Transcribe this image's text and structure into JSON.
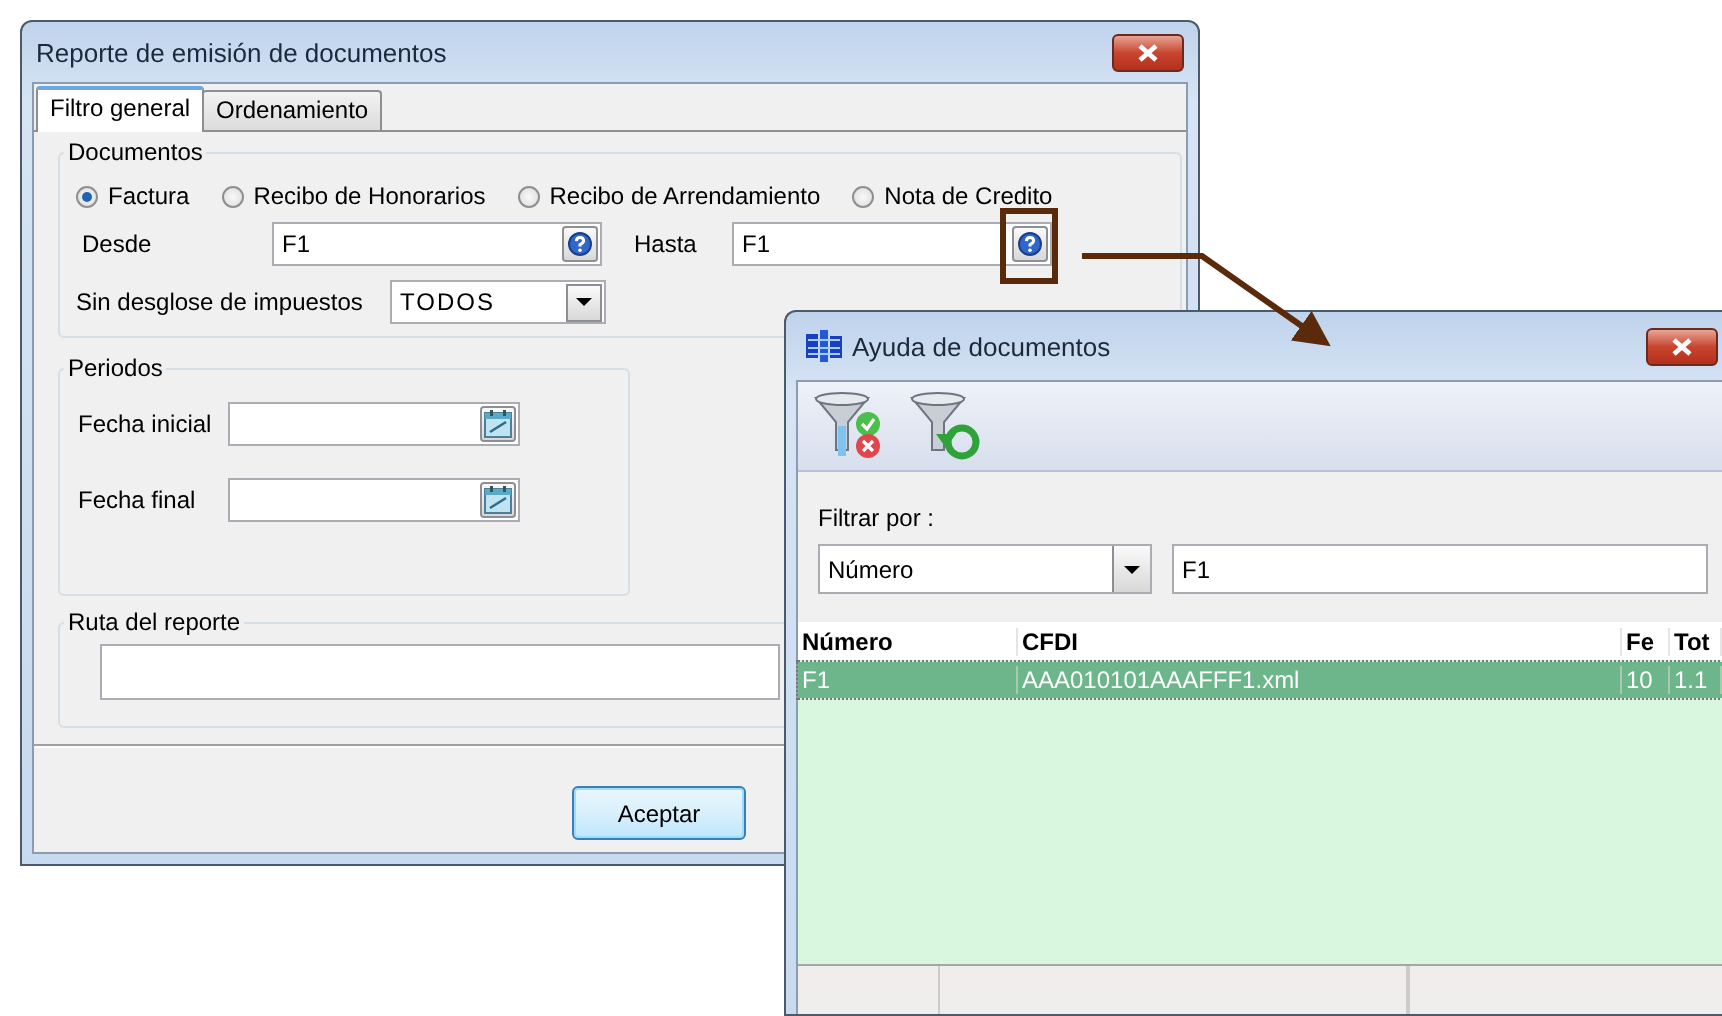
{
  "report_window": {
    "title": "Reporte de emisión de documentos",
    "tabs": [
      {
        "label": "Filtro general",
        "selected": true
      },
      {
        "label": "Ordenamiento",
        "selected": false
      }
    ],
    "documentos": {
      "legend": "Documentos",
      "options": [
        {
          "label": "Factura",
          "selected": true
        },
        {
          "label": "Recibo de Honorarios",
          "selected": false
        },
        {
          "label": "Recibo de Arrendamiento",
          "selected": false
        },
        {
          "label": "Nota de Credito",
          "selected": false
        }
      ],
      "desde": {
        "label": "Desde",
        "value": "F1"
      },
      "hasta": {
        "label": "Hasta",
        "value": "F1"
      },
      "sin_desglose": {
        "label": "Sin desglose de impuestos",
        "value": "TODOS"
      }
    },
    "periodos": {
      "legend": "Periodos",
      "fecha_inicial": {
        "label": "Fecha inicial"
      },
      "fecha_final": {
        "label": "Fecha final"
      }
    },
    "ruta": {
      "legend": "Ruta del reporte"
    },
    "buttons": [
      "Aceptar"
    ]
  },
  "help_window": {
    "title": "Ayuda de documentos",
    "filter": {
      "label": "Filtrar por :",
      "field": "Número",
      "value": "F1"
    },
    "table": {
      "columns": [
        "Número",
        "CFDI",
        "Fe",
        "Tot"
      ],
      "rows": [
        {
          "cells": [
            "F1",
            "AAA010101AAAFFF1.xml",
            "10",
            "1.1"
          ],
          "selected": true
        }
      ]
    }
  }
}
